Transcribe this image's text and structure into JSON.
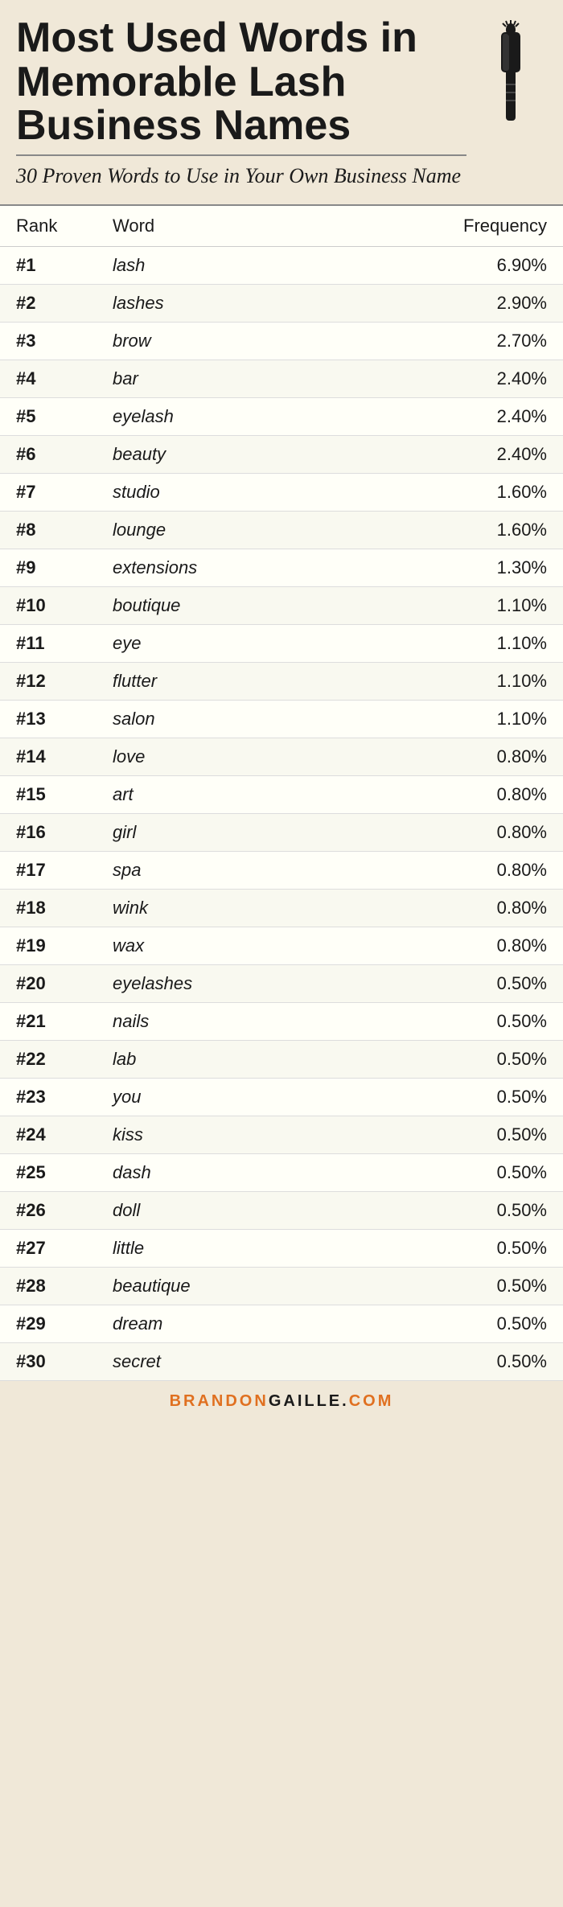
{
  "header": {
    "main_title": "Most Used Words in Memorable Lash Business Names",
    "subtitle": "30 Proven Words to Use in Your Own Business Name"
  },
  "table": {
    "columns": [
      "Rank",
      "Word",
      "Frequency"
    ],
    "rows": [
      {
        "rank": "#1",
        "word": "lash",
        "frequency": "6.90%"
      },
      {
        "rank": "#2",
        "word": "lashes",
        "frequency": "2.90%"
      },
      {
        "rank": "#3",
        "word": "brow",
        "frequency": "2.70%"
      },
      {
        "rank": "#4",
        "word": "bar",
        "frequency": "2.40%"
      },
      {
        "rank": "#5",
        "word": "eyelash",
        "frequency": "2.40%"
      },
      {
        "rank": "#6",
        "word": "beauty",
        "frequency": "2.40%"
      },
      {
        "rank": "#7",
        "word": "studio",
        "frequency": "1.60%"
      },
      {
        "rank": "#8",
        "word": "lounge",
        "frequency": "1.60%"
      },
      {
        "rank": "#9",
        "word": "extensions",
        "frequency": "1.30%"
      },
      {
        "rank": "#10",
        "word": "boutique",
        "frequency": "1.10%"
      },
      {
        "rank": "#11",
        "word": "eye",
        "frequency": "1.10%"
      },
      {
        "rank": "#12",
        "word": "flutter",
        "frequency": "1.10%"
      },
      {
        "rank": "#13",
        "word": "salon",
        "frequency": "1.10%"
      },
      {
        "rank": "#14",
        "word": "love",
        "frequency": "0.80%"
      },
      {
        "rank": "#15",
        "word": "art",
        "frequency": "0.80%"
      },
      {
        "rank": "#16",
        "word": "girl",
        "frequency": "0.80%"
      },
      {
        "rank": "#17",
        "word": "spa",
        "frequency": "0.80%"
      },
      {
        "rank": "#18",
        "word": "wink",
        "frequency": "0.80%"
      },
      {
        "rank": "#19",
        "word": "wax",
        "frequency": "0.80%"
      },
      {
        "rank": "#20",
        "word": "eyelashes",
        "frequency": "0.50%"
      },
      {
        "rank": "#21",
        "word": "nails",
        "frequency": "0.50%"
      },
      {
        "rank": "#22",
        "word": "lab",
        "frequency": "0.50%"
      },
      {
        "rank": "#23",
        "word": "you",
        "frequency": "0.50%"
      },
      {
        "rank": "#24",
        "word": "kiss",
        "frequency": "0.50%"
      },
      {
        "rank": "#25",
        "word": "dash",
        "frequency": "0.50%"
      },
      {
        "rank": "#26",
        "word": "doll",
        "frequency": "0.50%"
      },
      {
        "rank": "#27",
        "word": "little",
        "frequency": "0.50%"
      },
      {
        "rank": "#28",
        "word": "beautique",
        "frequency": "0.50%"
      },
      {
        "rank": "#29",
        "word": "dream",
        "frequency": "0.50%"
      },
      {
        "rank": "#30",
        "word": "secret",
        "frequency": "0.50%"
      }
    ]
  },
  "footer": {
    "brand_parts": [
      {
        "text": "BRANDON",
        "color": "highlight"
      },
      {
        "text": "GAILLE",
        "color": "normal"
      },
      {
        "text": ".",
        "color": "normal"
      },
      {
        "text": "COM",
        "color": "highlight"
      }
    ],
    "full_text": "BRANDONGAILLE.COM"
  }
}
